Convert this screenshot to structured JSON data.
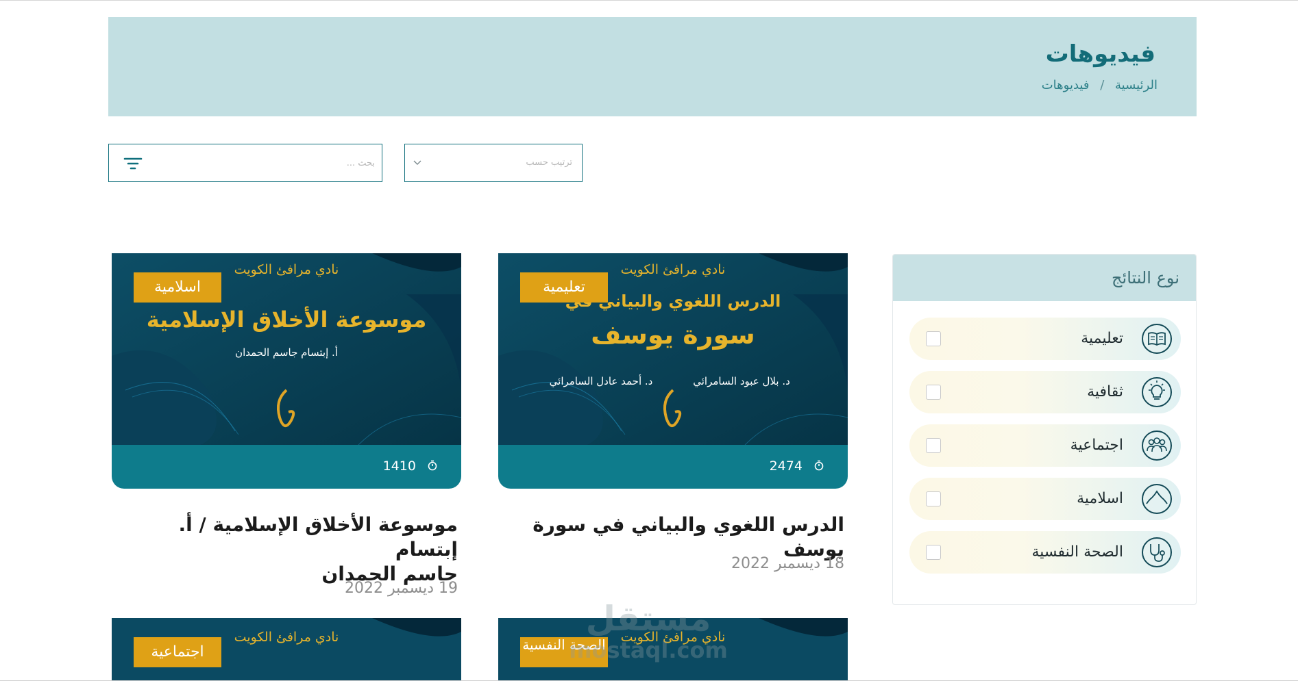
{
  "header": {
    "title": "فيديوهات",
    "breadcrumb": {
      "home": "الرئيسية",
      "separator": "/",
      "current": "فيديوهات"
    }
  },
  "controls": {
    "search_placeholder": "بحث ...",
    "sort_placeholder": "ترتيب حسب"
  },
  "sidebar": {
    "title": "نوع النتائج",
    "options": [
      {
        "label": "تعليمية",
        "icon": "book-icon",
        "checked": false
      },
      {
        "label": "ثقافية",
        "icon": "lightbulb-icon",
        "checked": false
      },
      {
        "label": "اجتماعية",
        "icon": "people-icon",
        "checked": false
      },
      {
        "label": "اسلامية",
        "icon": "dome-icon",
        "checked": false
      },
      {
        "label": "الصحة النفسية",
        "icon": "stethoscope-icon",
        "checked": false
      }
    ]
  },
  "videos": [
    {
      "badge": "تعليمية",
      "thumb": {
        "club": "نادي مرافئ الكويت",
        "line1": "الدرس اللغوي والبياني في",
        "line2": "سورة يوسف",
        "author1": "د. بلال عبود السامرائي",
        "author2": "د. أحمد عادل السامرائي"
      },
      "views": "2474",
      "title_lines": [
        "الدرس اللغوي والبياني في سورة يوسف"
      ],
      "date": "18 ديسمبر 2022"
    },
    {
      "badge": "اسلامية",
      "thumb": {
        "club": "نادي مرافئ الكويت",
        "line1": "موسوعة الأخلاق الإسلامية",
        "author1": "أ. إبتسام جاسم الحمدان"
      },
      "views": "1410",
      "title_lines": [
        "موسوعة الأخلاق الإسلامية / أ. إبتسام",
        "جاسم الحمدان"
      ],
      "date": "19 ديسمبر 2022"
    },
    {
      "badge": "الصحة النفسية",
      "thumb": {
        "club": "نادي مرافئ الكويت"
      }
    },
    {
      "badge": "اجتماعية",
      "thumb": {
        "club": "نادي مرافئ الكويت"
      }
    }
  ],
  "watermark": {
    "arabic": "مستقل",
    "latin": "mostaql.com"
  },
  "colors": {
    "teal": "#0e7c8c",
    "hero_bg": "#c2dfe2",
    "badge": "#dfa116",
    "thumb_bg": "#0c4a63"
  }
}
